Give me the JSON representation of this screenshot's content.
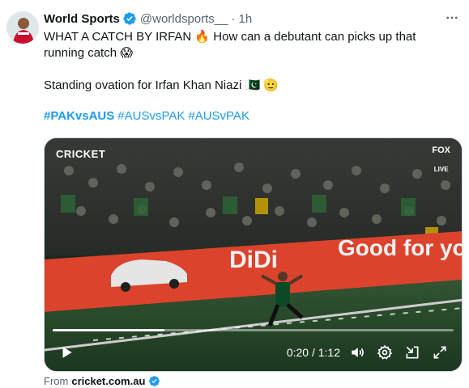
{
  "author": {
    "name": "World Sports",
    "handle": "@worldsports__",
    "time_sep": "·",
    "time": "1h"
  },
  "tweet": {
    "line1": "WHAT A CATCH BY IRFAN 🔥 How can a debutant can picks up that running catch 😱",
    "line2": "Standing ovation for Irfan Khan Niazi 🇵🇰 🫡",
    "hashtags": [
      "#PAKvsAUS",
      "#AUSvsPAK",
      "#AUSvPAK"
    ]
  },
  "video": {
    "timecode": "0:20 / 1:12",
    "progress": 0.2778,
    "overlay_left": "CRICKET",
    "overlay_right_top": "FOX",
    "overlay_right_bottom": "LIVE",
    "board_text_1": "DiDi",
    "board_text_2": "Good for yo"
  },
  "source": {
    "prefix": "From",
    "domain": "cricket.com.au"
  },
  "icons": {
    "verified": "verified-badge-icon",
    "more": "more-horizontal-icon",
    "play": "play-icon",
    "volume": "volume-icon",
    "settings": "settings-icon",
    "minimize": "minimize-icon",
    "fullscreen": "fullscreen-icon"
  },
  "colors": {
    "link": "#1d9bf0",
    "text": "#0f1419",
    "secondary": "#536471",
    "board": "#e8472f"
  }
}
